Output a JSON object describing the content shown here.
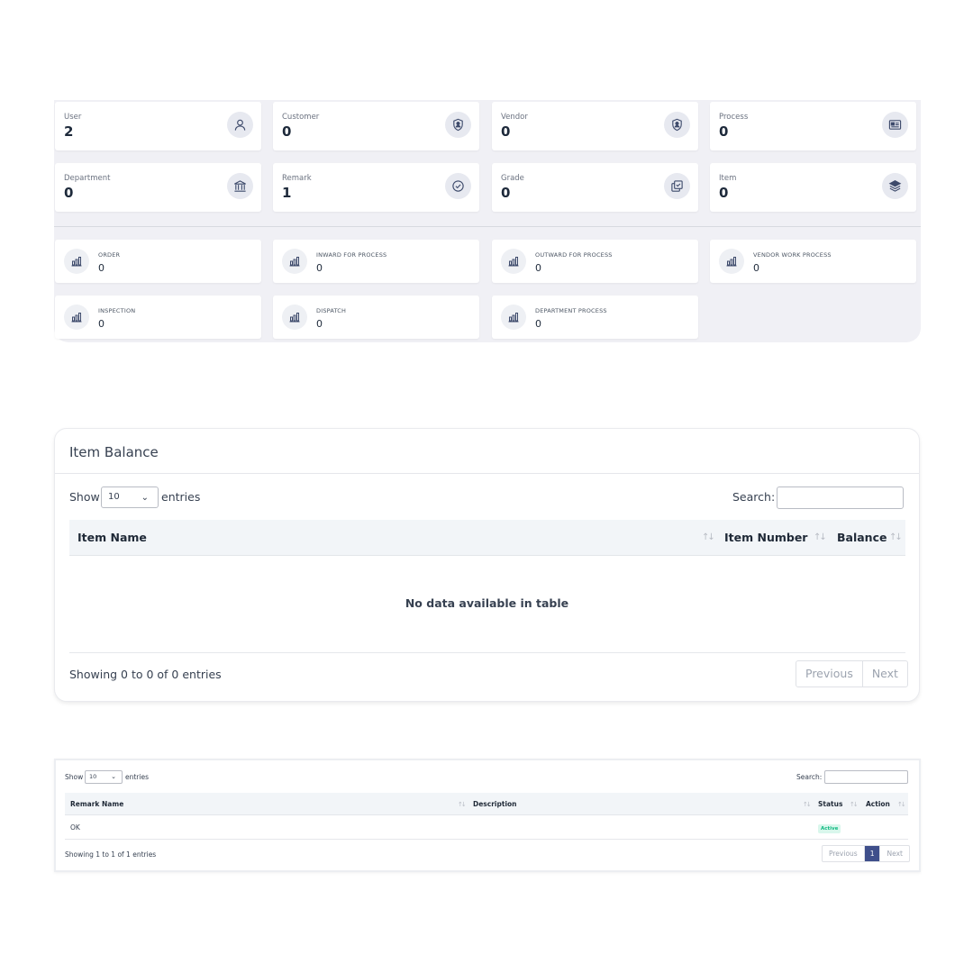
{
  "stats": [
    {
      "label": "User",
      "value": "2",
      "icon": "user-icon"
    },
    {
      "label": "Customer",
      "value": "0",
      "icon": "shield-user-icon"
    },
    {
      "label": "Vendor",
      "value": "0",
      "icon": "shield-user-icon"
    },
    {
      "label": "Process",
      "value": "0",
      "icon": "id-card-icon"
    },
    {
      "label": "Department",
      "value": "0",
      "icon": "bank-icon"
    },
    {
      "label": "Remark",
      "value": "1",
      "icon": "check-circle-icon"
    },
    {
      "label": "Grade",
      "value": "0",
      "icon": "copy-check-icon"
    },
    {
      "label": "Item",
      "value": "0",
      "icon": "layers-icon"
    }
  ],
  "processes": [
    {
      "label": "ORDER",
      "value": "0"
    },
    {
      "label": "INWARD FOR PROCESS",
      "value": "0"
    },
    {
      "label": "OUTWARD FOR PROCESS",
      "value": "0"
    },
    {
      "label": "VENDOR WORK PROCESS",
      "value": "0"
    },
    {
      "label": "INSPECTION",
      "value": "0"
    },
    {
      "label": "DISPATCH",
      "value": "0"
    },
    {
      "label": "DEPARTMENT PROCESS",
      "value": "0"
    }
  ],
  "item_balance": {
    "title": "Item Balance",
    "show_label": "Show",
    "page_size": "10",
    "entries_label": "entries",
    "search_label": "Search:",
    "columns": [
      "Item Name",
      "Item Number",
      "Balance"
    ],
    "empty_message": "No data available in table",
    "info": "Showing 0 to 0 of 0 entries",
    "prev_label": "Previous",
    "next_label": "Next"
  },
  "remarks": {
    "show_label": "Show",
    "page_size": "10",
    "entries_label": "entries",
    "search_label": "Search:",
    "columns": [
      "Remark Name",
      "Description",
      "Status",
      "Action"
    ],
    "rows": [
      {
        "name": "OK",
        "description": "",
        "status": "Active"
      }
    ],
    "info": "Showing 1 to 1 of 1 entries",
    "prev_label": "Previous",
    "current_page": "1",
    "next_label": "Next"
  },
  "colors": {
    "accent": "#3f4f8b",
    "active_badge": "#10b981",
    "panel_bg": "#f0f0f5"
  }
}
